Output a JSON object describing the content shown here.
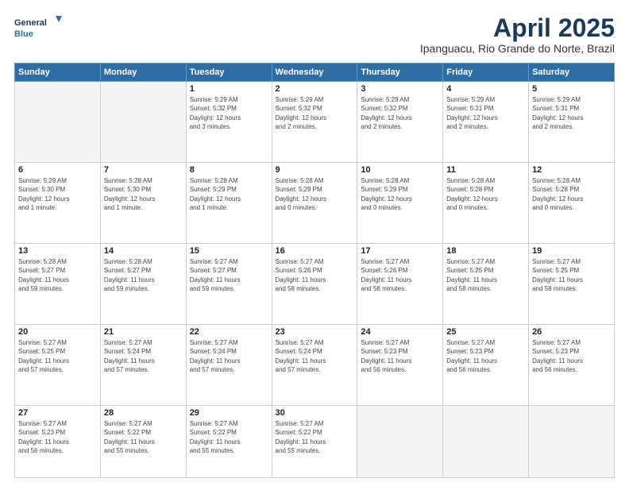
{
  "header": {
    "logo_line1": "General",
    "logo_line2": "Blue",
    "month": "April 2025",
    "location": "Ipanguacu, Rio Grande do Norte, Brazil"
  },
  "weekdays": [
    "Sunday",
    "Monday",
    "Tuesday",
    "Wednesday",
    "Thursday",
    "Friday",
    "Saturday"
  ],
  "weeks": [
    [
      {
        "day": "",
        "info": ""
      },
      {
        "day": "",
        "info": ""
      },
      {
        "day": "1",
        "info": "Sunrise: 5:29 AM\nSunset: 5:32 PM\nDaylight: 12 hours\nand 3 minutes."
      },
      {
        "day": "2",
        "info": "Sunrise: 5:29 AM\nSunset: 5:32 PM\nDaylight: 12 hours\nand 2 minutes."
      },
      {
        "day": "3",
        "info": "Sunrise: 5:29 AM\nSunset: 5:32 PM\nDaylight: 12 hours\nand 2 minutes."
      },
      {
        "day": "4",
        "info": "Sunrise: 5:29 AM\nSunset: 5:31 PM\nDaylight: 12 hours\nand 2 minutes."
      },
      {
        "day": "5",
        "info": "Sunrise: 5:29 AM\nSunset: 5:31 PM\nDaylight: 12 hours\nand 2 minutes."
      }
    ],
    [
      {
        "day": "6",
        "info": "Sunrise: 5:29 AM\nSunset: 5:30 PM\nDaylight: 12 hours\nand 1 minute."
      },
      {
        "day": "7",
        "info": "Sunrise: 5:28 AM\nSunset: 5:30 PM\nDaylight: 12 hours\nand 1 minute."
      },
      {
        "day": "8",
        "info": "Sunrise: 5:28 AM\nSunset: 5:29 PM\nDaylight: 12 hours\nand 1 minute."
      },
      {
        "day": "9",
        "info": "Sunrise: 5:28 AM\nSunset: 5:29 PM\nDaylight: 12 hours\nand 0 minutes."
      },
      {
        "day": "10",
        "info": "Sunrise: 5:28 AM\nSunset: 5:29 PM\nDaylight: 12 hours\nand 0 minutes."
      },
      {
        "day": "11",
        "info": "Sunrise: 5:28 AM\nSunset: 5:28 PM\nDaylight: 12 hours\nand 0 minutes."
      },
      {
        "day": "12",
        "info": "Sunrise: 5:28 AM\nSunset: 5:28 PM\nDaylight: 12 hours\nand 0 minutes."
      }
    ],
    [
      {
        "day": "13",
        "info": "Sunrise: 5:28 AM\nSunset: 5:27 PM\nDaylight: 11 hours\nand 59 minutes."
      },
      {
        "day": "14",
        "info": "Sunrise: 5:28 AM\nSunset: 5:27 PM\nDaylight: 11 hours\nand 59 minutes."
      },
      {
        "day": "15",
        "info": "Sunrise: 5:27 AM\nSunset: 5:27 PM\nDaylight: 11 hours\nand 59 minutes."
      },
      {
        "day": "16",
        "info": "Sunrise: 5:27 AM\nSunset: 5:26 PM\nDaylight: 11 hours\nand 58 minutes."
      },
      {
        "day": "17",
        "info": "Sunrise: 5:27 AM\nSunset: 5:26 PM\nDaylight: 11 hours\nand 58 minutes."
      },
      {
        "day": "18",
        "info": "Sunrise: 5:27 AM\nSunset: 5:25 PM\nDaylight: 11 hours\nand 58 minutes."
      },
      {
        "day": "19",
        "info": "Sunrise: 5:27 AM\nSunset: 5:25 PM\nDaylight: 11 hours\nand 58 minutes."
      }
    ],
    [
      {
        "day": "20",
        "info": "Sunrise: 5:27 AM\nSunset: 5:25 PM\nDaylight: 11 hours\nand 57 minutes."
      },
      {
        "day": "21",
        "info": "Sunrise: 5:27 AM\nSunset: 5:24 PM\nDaylight: 11 hours\nand 57 minutes."
      },
      {
        "day": "22",
        "info": "Sunrise: 5:27 AM\nSunset: 5:24 PM\nDaylight: 11 hours\nand 57 minutes."
      },
      {
        "day": "23",
        "info": "Sunrise: 5:27 AM\nSunset: 5:24 PM\nDaylight: 11 hours\nand 57 minutes."
      },
      {
        "day": "24",
        "info": "Sunrise: 5:27 AM\nSunset: 5:23 PM\nDaylight: 11 hours\nand 56 minutes."
      },
      {
        "day": "25",
        "info": "Sunrise: 5:27 AM\nSunset: 5:23 PM\nDaylight: 11 hours\nand 56 minutes."
      },
      {
        "day": "26",
        "info": "Sunrise: 5:27 AM\nSunset: 5:23 PM\nDaylight: 11 hours\nand 56 minutes."
      }
    ],
    [
      {
        "day": "27",
        "info": "Sunrise: 5:27 AM\nSunset: 5:23 PM\nDaylight: 11 hours\nand 56 minutes."
      },
      {
        "day": "28",
        "info": "Sunrise: 5:27 AM\nSunset: 5:22 PM\nDaylight: 11 hours\nand 55 minutes."
      },
      {
        "day": "29",
        "info": "Sunrise: 5:27 AM\nSunset: 5:22 PM\nDaylight: 11 hours\nand 55 minutes."
      },
      {
        "day": "30",
        "info": "Sunrise: 5:27 AM\nSunset: 5:22 PM\nDaylight: 11 hours\nand 55 minutes."
      },
      {
        "day": "",
        "info": ""
      },
      {
        "day": "",
        "info": ""
      },
      {
        "day": "",
        "info": ""
      }
    ]
  ]
}
